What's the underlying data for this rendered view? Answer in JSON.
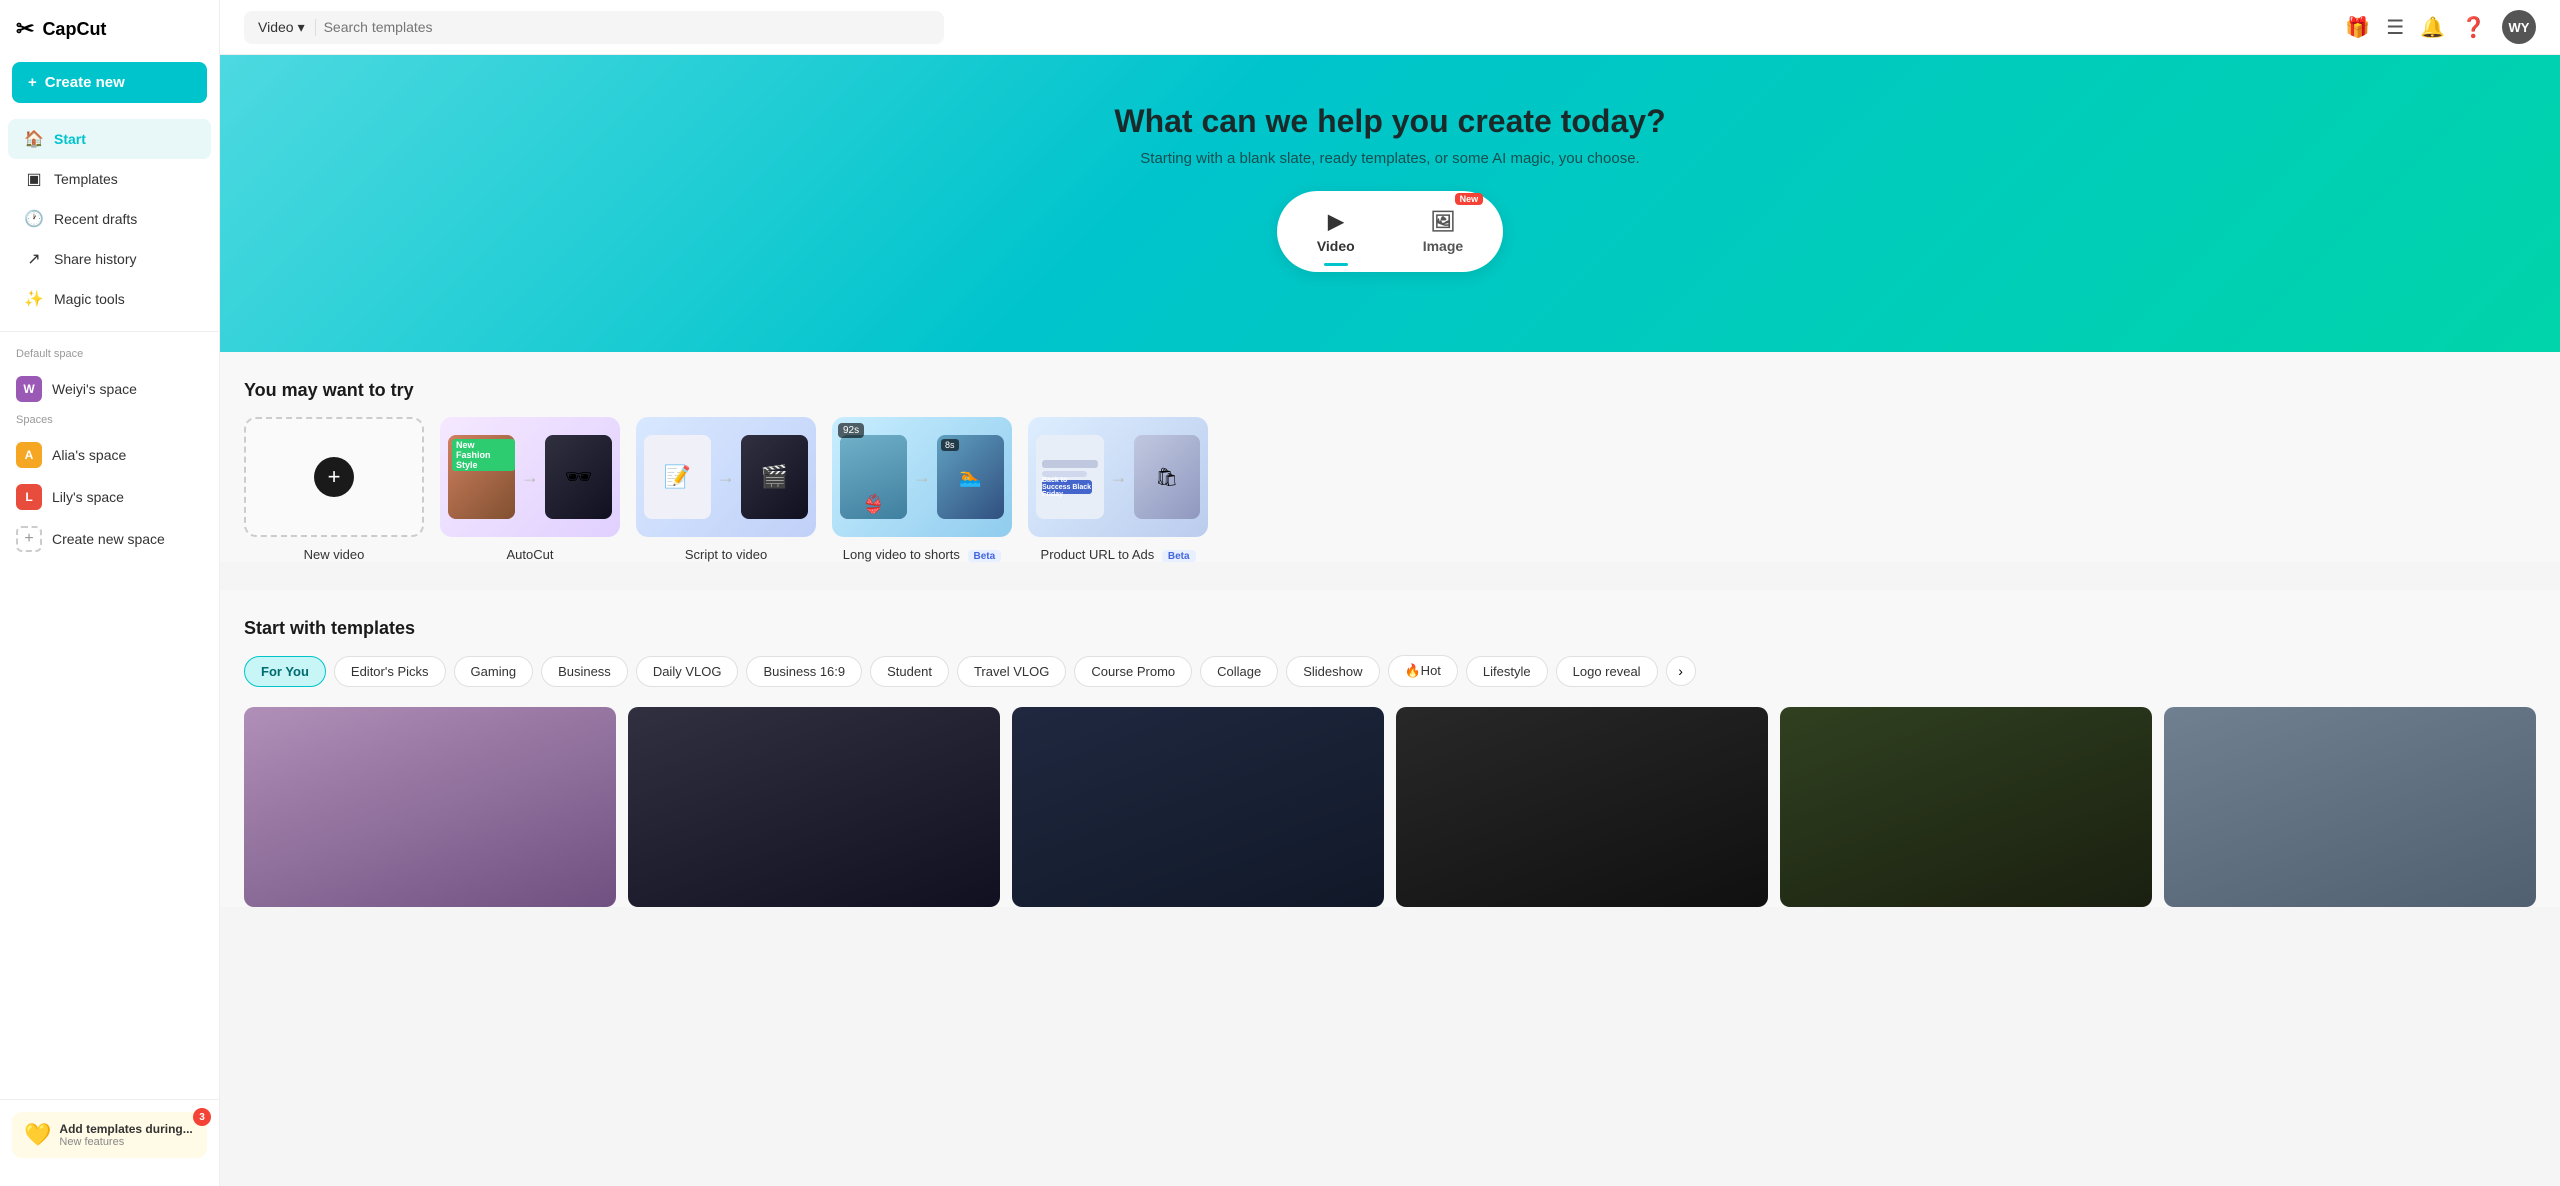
{
  "app": {
    "name": "CapCut",
    "logo_symbol": "✂"
  },
  "sidebar": {
    "create_new_label": "+ Create new",
    "nav_items": [
      {
        "id": "start",
        "label": "Start",
        "icon": "🏠",
        "active": true
      },
      {
        "id": "templates",
        "label": "Templates",
        "icon": "⬜"
      },
      {
        "id": "recent_drafts",
        "label": "Recent drafts",
        "icon": "🕐"
      },
      {
        "id": "share_history",
        "label": "Share history",
        "icon": "↗"
      },
      {
        "id": "magic_tools",
        "label": "Magic tools",
        "icon": "✨"
      }
    ],
    "default_space_label": "Default space",
    "default_space_name": "Weiyi's space",
    "spaces_label": "Spaces",
    "spaces": [
      {
        "id": "alia",
        "label": "Alia's space",
        "initial": "A",
        "color": "#f5a623"
      },
      {
        "id": "lily",
        "label": "Lily's space",
        "initial": "L",
        "color": "#e74c3c"
      }
    ],
    "create_space_label": "Create new space",
    "bottom_card": {
      "icon": "💛",
      "title": "Add templates during...",
      "subtitle": "New features",
      "badge": "3"
    }
  },
  "header": {
    "search_dropdown": "Video",
    "search_placeholder": "Search templates",
    "icons": [
      "🎁",
      "☰",
      "🔔",
      "❓"
    ],
    "avatar_initials": "WY"
  },
  "hero": {
    "title": "What can we help you create today?",
    "subtitle": "Starting with a blank slate, ready templates, or some AI magic, you choose.",
    "tabs": [
      {
        "id": "video",
        "label": "Video",
        "icon": "▶",
        "active": true,
        "new_badge": false
      },
      {
        "id": "image",
        "label": "Image",
        "icon": "🖼",
        "active": false,
        "new_badge": true
      }
    ]
  },
  "try_section": {
    "title": "You may want to try",
    "cards": [
      {
        "id": "new_video",
        "label": "New video",
        "type": "new"
      },
      {
        "id": "autocut",
        "label": "AutoCut",
        "type": "template"
      },
      {
        "id": "script_to_video",
        "label": "Script to video",
        "type": "template"
      },
      {
        "id": "long_video",
        "label": "Long video to shorts",
        "type": "template",
        "badge": "Beta"
      },
      {
        "id": "product_url",
        "label": "Product URL to Ads",
        "type": "template",
        "badge": "Beta"
      }
    ]
  },
  "templates_section": {
    "title": "Start with templates",
    "tabs": [
      {
        "id": "for_you",
        "label": "For You",
        "active": true
      },
      {
        "id": "editors_picks",
        "label": "Editor's Picks",
        "active": false
      },
      {
        "id": "gaming",
        "label": "Gaming",
        "active": false
      },
      {
        "id": "business",
        "label": "Business",
        "active": false
      },
      {
        "id": "daily_vlog",
        "label": "Daily VLOG",
        "active": false
      },
      {
        "id": "business_169",
        "label": "Business 16:9",
        "active": false
      },
      {
        "id": "student",
        "label": "Student",
        "active": false
      },
      {
        "id": "travel_vlog",
        "label": "Travel VLOG",
        "active": false
      },
      {
        "id": "course_promo",
        "label": "Course Promo",
        "active": false
      },
      {
        "id": "collage",
        "label": "Collage",
        "active": false
      },
      {
        "id": "slideshow",
        "label": "Slideshow",
        "active": false
      },
      {
        "id": "hot",
        "label": "🔥Hot",
        "active": false
      },
      {
        "id": "lifestyle",
        "label": "Lifestyle",
        "active": false
      },
      {
        "id": "logo_reveal",
        "label": "Logo reveal",
        "active": false
      }
    ],
    "next_label": "›"
  }
}
